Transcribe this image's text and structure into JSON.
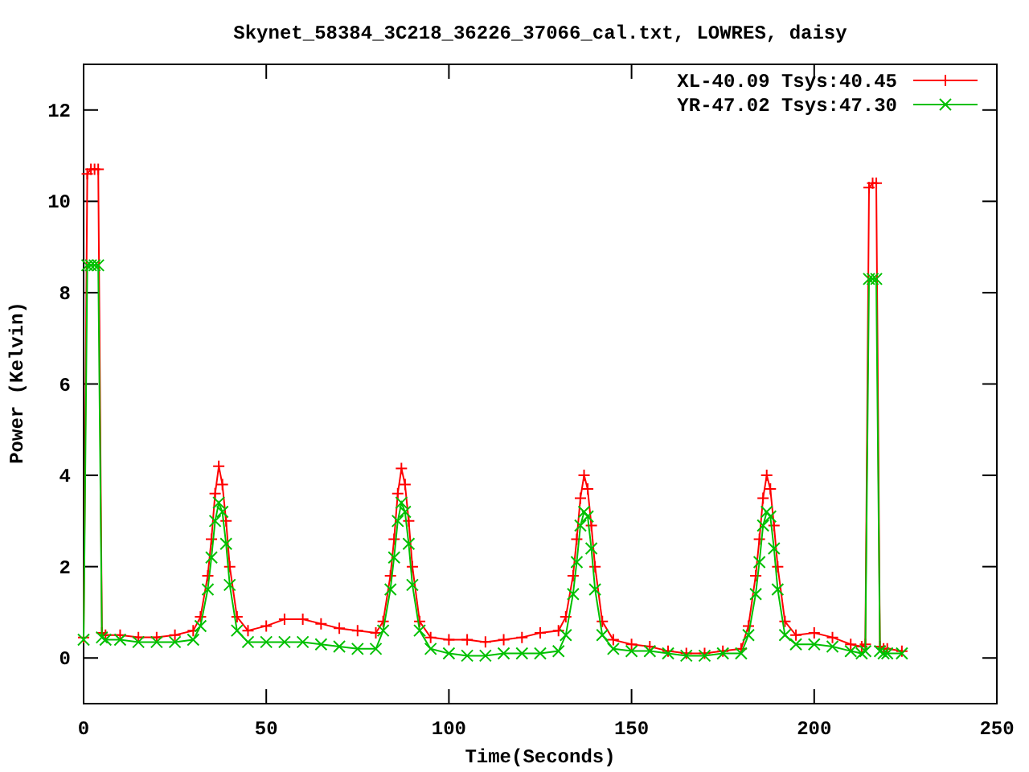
{
  "chart_data": {
    "type": "line",
    "title": "Skynet_58384_3C218_36226_37066_cal.txt, LOWRES, daisy",
    "xlabel": "Time(Seconds)",
    "ylabel": "Power (Kelvin)",
    "x": [
      0,
      1,
      2,
      3,
      4,
      5,
      6,
      10,
      15,
      20,
      25,
      30,
      32,
      34,
      35,
      36,
      37,
      38,
      39,
      40,
      42,
      45,
      50,
      55,
      60,
      65,
      70,
      75,
      80,
      82,
      84,
      85,
      86,
      87,
      88,
      89,
      90,
      92,
      95,
      100,
      105,
      110,
      115,
      120,
      125,
      130,
      132,
      134,
      135,
      136,
      137,
      138,
      139,
      140,
      142,
      145,
      150,
      155,
      160,
      165,
      170,
      175,
      180,
      182,
      184,
      185,
      186,
      187,
      188,
      189,
      190,
      192,
      195,
      200,
      205,
      210,
      213,
      214,
      215,
      216,
      217,
      218,
      219,
      220,
      224
    ],
    "series": [
      {
        "name": "XL-40.09 Tsys:40.45",
        "color": "#ff0000",
        "marker": "plus",
        "values": [
          0.45,
          10.6,
          10.7,
          10.7,
          10.7,
          0.55,
          0.5,
          0.5,
          0.45,
          0.45,
          0.5,
          0.6,
          0.9,
          1.8,
          2.6,
          3.6,
          4.2,
          3.8,
          3.0,
          2.0,
          0.9,
          0.6,
          0.7,
          0.85,
          0.85,
          0.75,
          0.65,
          0.6,
          0.55,
          0.8,
          1.8,
          2.6,
          3.6,
          4.15,
          3.8,
          3.0,
          2.0,
          0.8,
          0.45,
          0.4,
          0.4,
          0.35,
          0.4,
          0.45,
          0.55,
          0.6,
          0.9,
          1.8,
          2.6,
          3.5,
          4.0,
          3.7,
          2.9,
          2.0,
          0.8,
          0.4,
          0.3,
          0.25,
          0.15,
          0.1,
          0.1,
          0.15,
          0.2,
          0.7,
          1.8,
          2.6,
          3.5,
          4.0,
          3.7,
          2.9,
          2.0,
          0.8,
          0.5,
          0.55,
          0.45,
          0.3,
          0.25,
          0.3,
          10.3,
          10.4,
          10.4,
          0.25,
          0.2,
          0.2,
          0.15
        ]
      },
      {
        "name": "YR-47.02 Tsys:47.30",
        "color": "#00c000",
        "marker": "cross",
        "values": [
          0.4,
          8.6,
          8.6,
          8.6,
          8.6,
          0.45,
          0.4,
          0.4,
          0.35,
          0.35,
          0.35,
          0.4,
          0.7,
          1.5,
          2.2,
          3.0,
          3.4,
          3.2,
          2.5,
          1.6,
          0.6,
          0.35,
          0.35,
          0.35,
          0.35,
          0.3,
          0.25,
          0.2,
          0.2,
          0.6,
          1.5,
          2.2,
          3.0,
          3.4,
          3.2,
          2.5,
          1.6,
          0.6,
          0.2,
          0.1,
          0.05,
          0.05,
          0.1,
          0.1,
          0.1,
          0.15,
          0.5,
          1.4,
          2.1,
          2.9,
          3.2,
          3.1,
          2.4,
          1.5,
          0.5,
          0.2,
          0.15,
          0.15,
          0.1,
          0.05,
          0.05,
          0.1,
          0.1,
          0.5,
          1.4,
          2.1,
          2.9,
          3.2,
          3.1,
          2.4,
          1.5,
          0.5,
          0.3,
          0.3,
          0.25,
          0.15,
          0.1,
          0.15,
          8.3,
          8.3,
          8.3,
          0.15,
          0.1,
          0.1,
          0.1
        ]
      }
    ],
    "legend": true,
    "xlim": [
      0,
      250
    ],
    "ylim": [
      -1,
      13
    ],
    "xticks": [
      0,
      50,
      100,
      150,
      200,
      250
    ],
    "yticks": [
      0,
      2,
      4,
      6,
      8,
      10,
      12
    ]
  }
}
